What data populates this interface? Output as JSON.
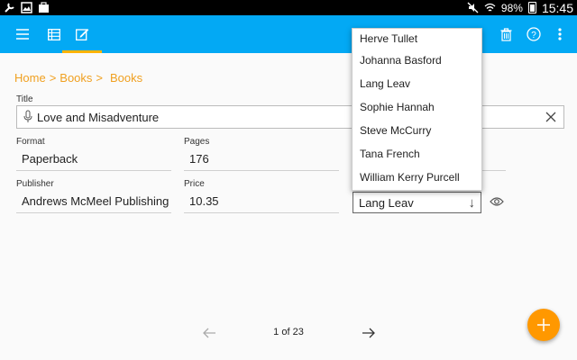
{
  "status_bar": {
    "battery": "98%",
    "time": "15:45"
  },
  "breadcrumb": {
    "home": "Home",
    "sep1": ">",
    "books": "Books",
    "sep2": ">",
    "current": "Books"
  },
  "form": {
    "title_label": "Title",
    "title_value": "Love and Misadventure",
    "format_label": "Format",
    "format_value": "Paperback",
    "pages_label": "Pages",
    "pages_value": "176",
    "publisher_label": "Publisher",
    "publisher_value": "Andrews McMeel Publishing",
    "price_label": "Price",
    "price_value": "10.35",
    "author_value": "Lang Leav"
  },
  "author_dropdown": {
    "options": [
      "Herve Tullet",
      "Johanna Basford",
      "Lang Leav",
      "Sophie Hannah",
      "Steve McCurry",
      "Tana French",
      "William Kerry Purcell"
    ]
  },
  "pager": {
    "text": "1 of 23"
  },
  "icons": {
    "menu": "menu-icon",
    "table": "table-icon",
    "edit": "edit-icon",
    "delete": "trash-icon",
    "help": "help-icon",
    "more": "more-vert-icon",
    "fab": "plus-icon"
  },
  "colors": {
    "appbar": "#03a9f4",
    "accent": "#ffb300",
    "breadcrumb": "#f0a020",
    "fab": "#ff9800"
  }
}
